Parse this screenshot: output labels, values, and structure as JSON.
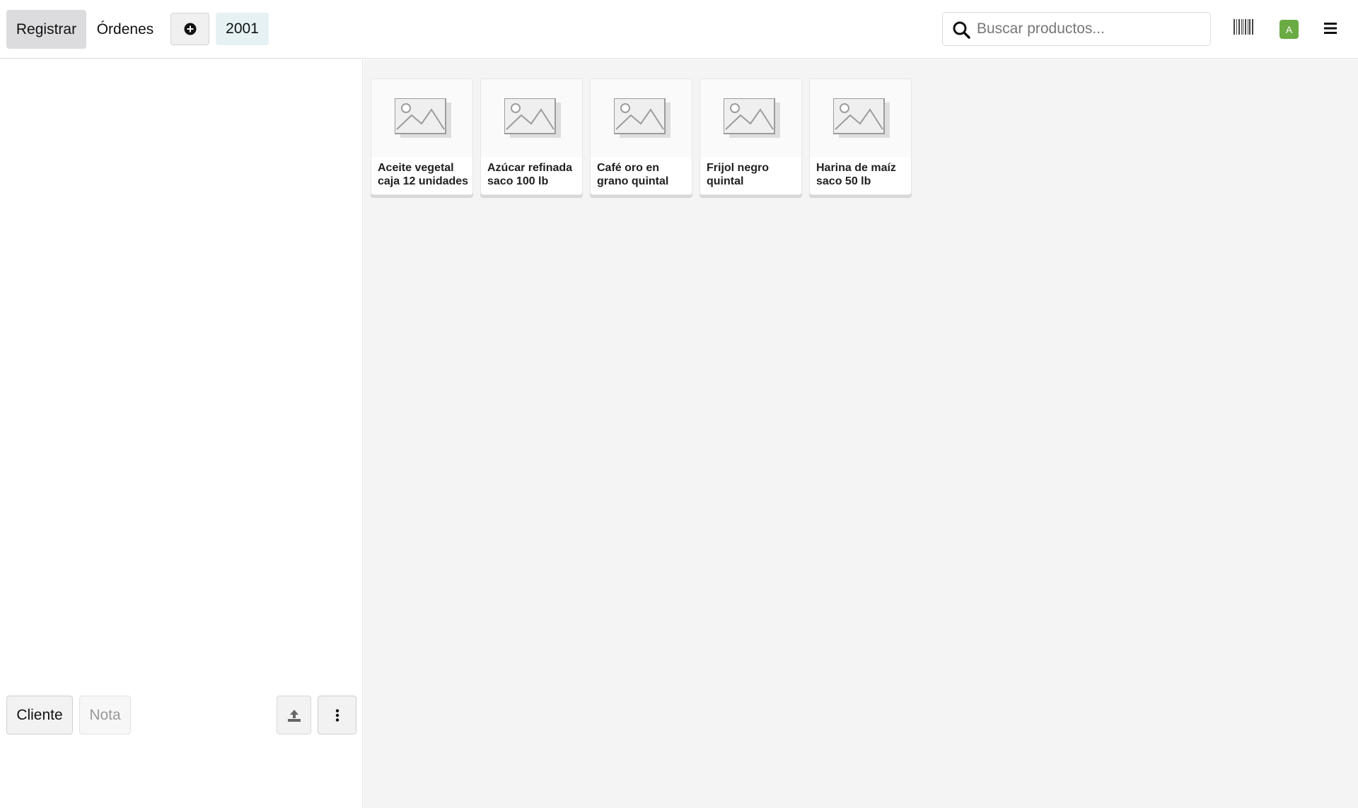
{
  "header": {
    "register_label": "Registrar",
    "orders_label": "Órdenes",
    "current_order": "2001",
    "search_placeholder": "Buscar productos...",
    "avatar_initial": "A",
    "avatar_color": "#6bab43"
  },
  "order_panel": {
    "customer_label": "Cliente",
    "note_label": "Nota"
  },
  "products": [
    {
      "name": "Aceite vegetal caja 12 unidades",
      "image": "placeholder-image-icon"
    },
    {
      "name": "Azúcar refinada saco 100 lb",
      "image": "placeholder-image-icon"
    },
    {
      "name": "Café oro en grano quintal",
      "image": "placeholder-image-icon"
    },
    {
      "name": "Frijol negro quintal",
      "image": "placeholder-image-icon"
    },
    {
      "name": "Harina de maíz saco 50 lb",
      "image": "placeholder-image-icon"
    }
  ],
  "icons": {
    "new_order": "plus-circle-icon",
    "search": "search-icon",
    "barcode": "barcode-icon",
    "menu": "hamburger-menu-icon",
    "upload": "upload-icon",
    "more": "vertical-dots-icon"
  }
}
